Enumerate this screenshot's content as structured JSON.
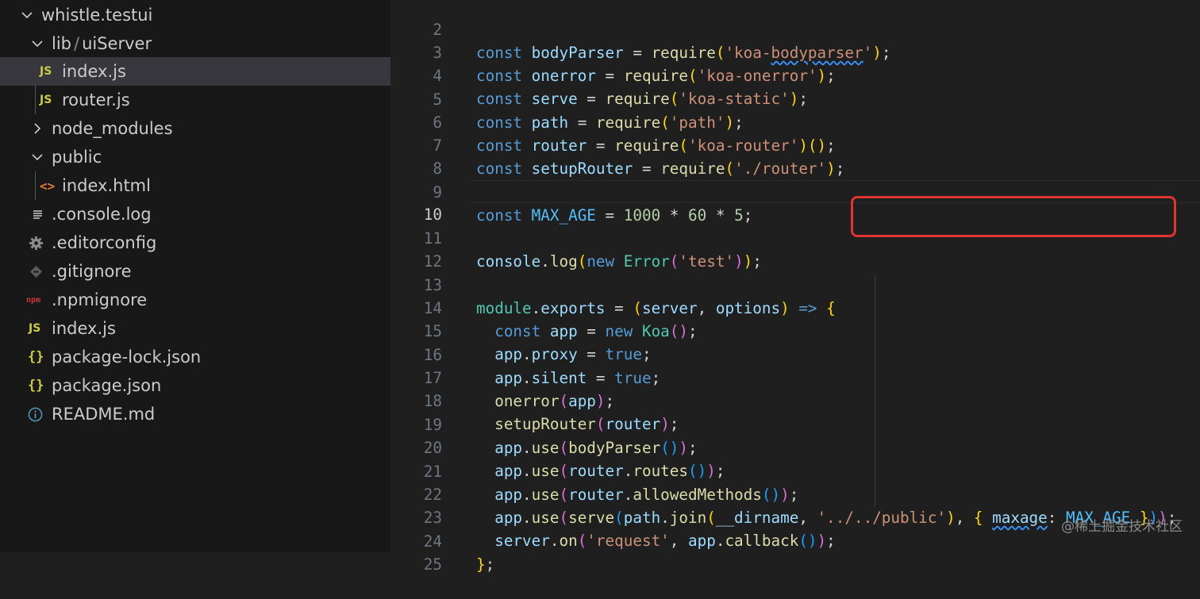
{
  "explorer": {
    "root_folder": "whistle.testui",
    "lib_folder": "lib",
    "lib_sep": "/",
    "uiserver_folder": "uiServer",
    "files": {
      "index_js_ui": "index.js",
      "router_js": "router.js",
      "node_modules": "node_modules",
      "public": "public",
      "index_html": "index.html",
      "console_log": ".console.log",
      "editorconfig": ".editorconfig",
      "gitignore": ".gitignore",
      "npmignore": ".npmignore",
      "index_js_root": "index.js",
      "package_lock": "package-lock.json",
      "package_json": "package.json",
      "readme": "README.md"
    },
    "icons": {
      "js_label": "JS",
      "json_label": "{}",
      "html_label": "<>",
      "npm_label": "npm"
    }
  },
  "editor": {
    "line_numbers": [
      "2",
      "3",
      "4",
      "5",
      "6",
      "7",
      "8",
      "9",
      "10",
      "11",
      "12",
      "13",
      "14",
      "15",
      "16",
      "17",
      "18",
      "19",
      "20",
      "21",
      "22",
      "23",
      "24",
      "25"
    ],
    "active_line": "10",
    "highlighted_code": "console.log(new Error('test'));"
  },
  "watermark": "@稀土掘金技术社区",
  "colors": {
    "sidebar_bg": "#181818",
    "editor_bg": "#1f1f1f",
    "selection_bg": "#37373d",
    "highlight_box": "#e0342f",
    "keyword": "#569cd6",
    "variable": "#9cdcfe",
    "function": "#dcdcaa",
    "string": "#ce9178",
    "number": "#b5cea8"
  }
}
